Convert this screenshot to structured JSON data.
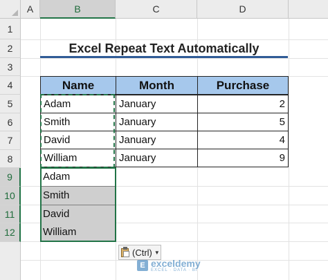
{
  "column_headers": [
    "A",
    "B",
    "C",
    "D"
  ],
  "selected_column": "B",
  "row_headers": [
    "1",
    "2",
    "3",
    "4",
    "5",
    "6",
    "7",
    "8",
    "9",
    "10",
    "11",
    "12"
  ],
  "selected_rows": [
    "9",
    "10",
    "11",
    "12"
  ],
  "title": "Excel Repeat Text Automatically",
  "table": {
    "headers": [
      "Name",
      "Month",
      "Purchase"
    ],
    "rows": [
      {
        "name": "Adam",
        "month": "January",
        "purchase": "2"
      },
      {
        "name": "Smith",
        "month": "January",
        "purchase": "5"
      },
      {
        "name": "David",
        "month": "January",
        "purchase": "4"
      },
      {
        "name": "William",
        "month": "January",
        "purchase": "9"
      }
    ]
  },
  "pasted_values": [
    "Adam",
    "Smith",
    "David",
    "William"
  ],
  "paste_options": {
    "label": "(Ctrl)"
  },
  "watermark": {
    "logo": "E",
    "name": "exceldemy",
    "tagline": "EXCEL · DATA · BI"
  },
  "colors": {
    "header_fill": "#a6c8ec",
    "selection_accent": "#217346",
    "title_underline": "#2f5b96"
  }
}
